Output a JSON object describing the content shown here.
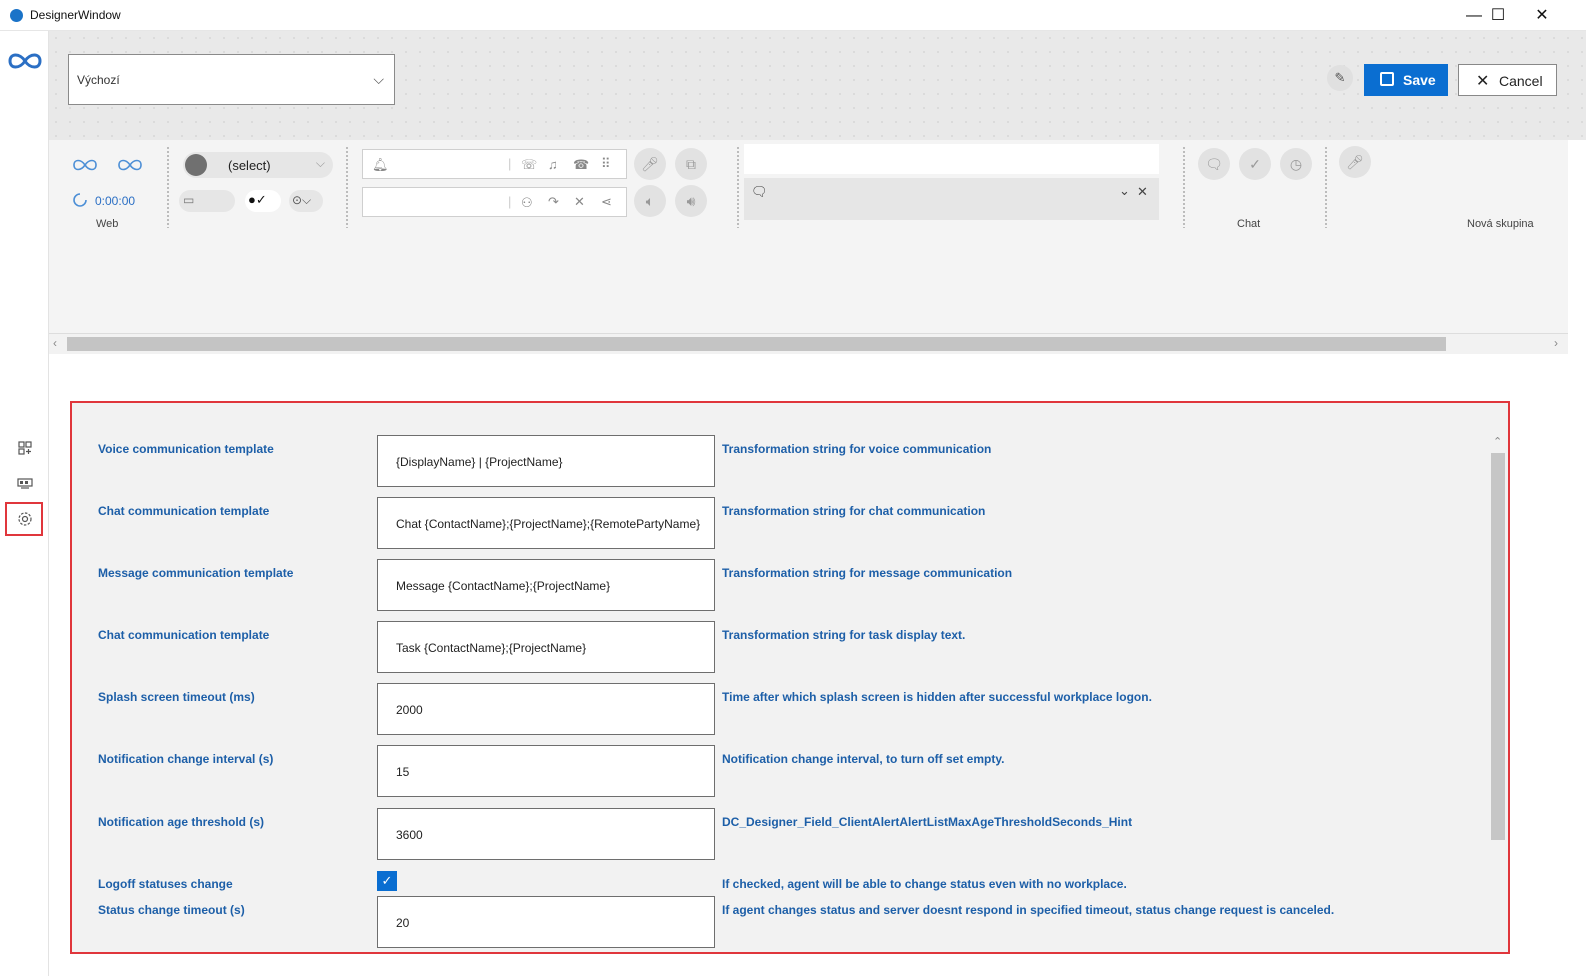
{
  "window": {
    "title": "DesignerWindow",
    "minimize": "—",
    "maximize": "☐",
    "close": "✕"
  },
  "top": {
    "layout_select_value": "Výchozí",
    "save_label": "Save",
    "cancel_label": "Cancel"
  },
  "toolbar": {
    "web_label": "Web",
    "timer": "0:00:00",
    "status_select": "(select)",
    "chat_label": "Chat",
    "new_group_label": "Nová skupina"
  },
  "settings": [
    {
      "label": "Voice communication template",
      "value": "{DisplayName} | {ProjectName}",
      "hint": "Transformation string for voice communication"
    },
    {
      "label": "Chat communication template",
      "value": "Chat {ContactName};{ProjectName};{RemotePartyName}",
      "hint": "Transformation string for chat communication"
    },
    {
      "label": "Message communication template",
      "value": "Message {ContactName};{ProjectName}",
      "hint": "Transformation string for message communication"
    },
    {
      "label": "Chat communication template",
      "value": "Task {ContactName};{ProjectName}",
      "hint": "Transformation string for task display text."
    },
    {
      "label": "Splash screen timeout (ms)",
      "value": "2000",
      "hint": "Time after which splash screen is hidden after successful workplace logon."
    },
    {
      "label": "Notification change interval (s)",
      "value": "15",
      "hint": "Notification change interval, to turn off set empty."
    },
    {
      "label": "Notification age threshold (s)",
      "value": "3600",
      "hint": "DC_Designer_Field_ClientAlertAlertListMaxAgeThresholdSeconds_Hint"
    }
  ],
  "logoff": {
    "label": "Logoff statuses change",
    "checked": true,
    "hint": "If checked, agent will be able to change status even with no workplace."
  },
  "status_timeout": {
    "label": "Status change timeout (s)",
    "value": "20",
    "hint": "If agent changes status and server doesnt respond in specified timeout, status change request is canceled."
  },
  "colors": {
    "accent": "#0a6ed1",
    "label_blue": "#1d5fa8",
    "highlight_red": "#e0363c"
  }
}
